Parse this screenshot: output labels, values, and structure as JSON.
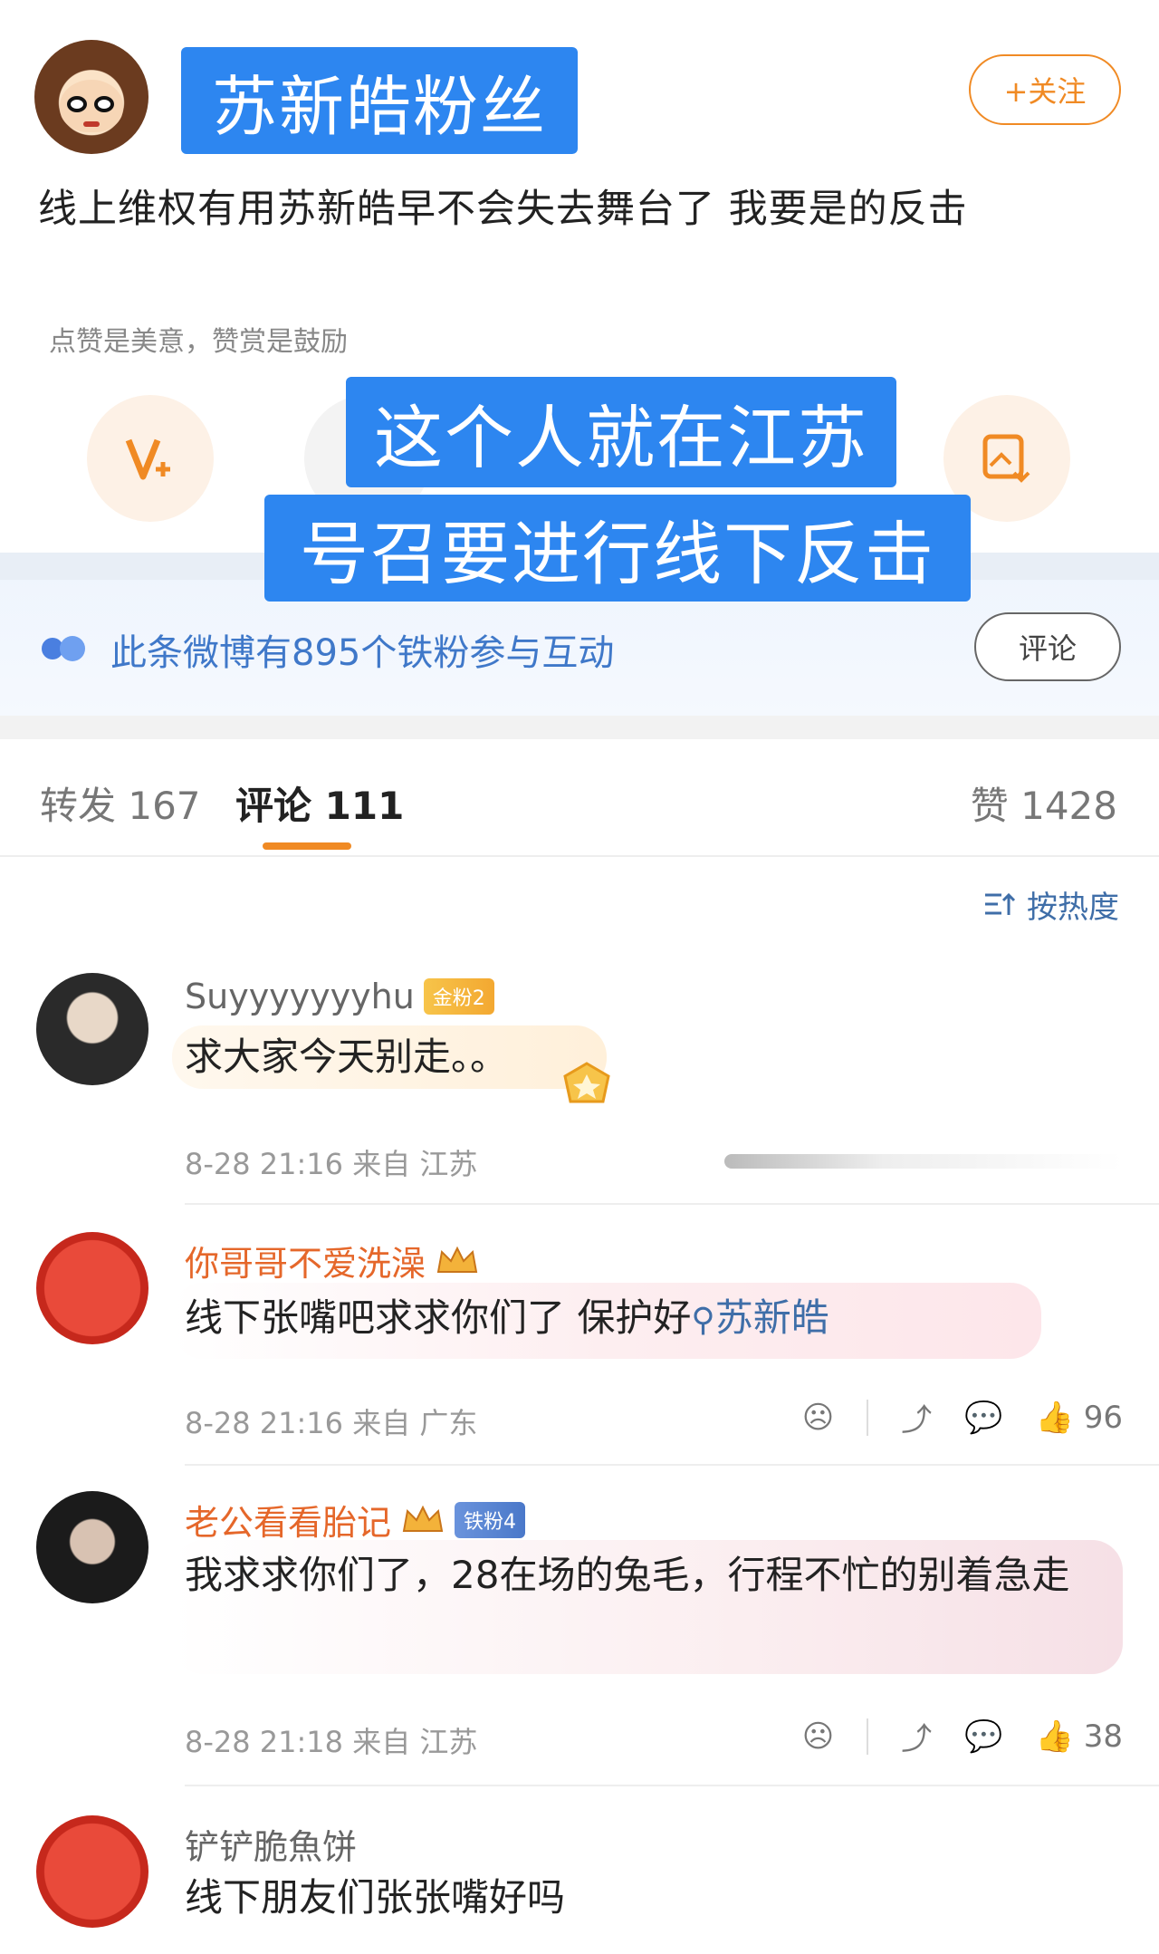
{
  "post": {
    "username": "苏新皓粉丝",
    "follow_label": "+关注",
    "text": "线上维权有用苏新皓早不会失去舞台了 我要是的反击",
    "reward_caption": "点赞是美意，赞赏是鼓励"
  },
  "overlay": {
    "line1": "这个人就在江苏",
    "line2": "号召要进行线下反击"
  },
  "fans_band": {
    "text": "此条微博有895个铁粉参与互动",
    "comment_button": "评论"
  },
  "tabs": {
    "repost": "转发 167",
    "comments": "评论 111",
    "likes": "赞 1428"
  },
  "sort_label": "按热度",
  "comments": [
    {
      "name": "Suyyyyyyyhu",
      "badge": "金粉2",
      "text": "求大家今天别走。。",
      "meta": "8-28 21:16 来自 江苏"
    },
    {
      "name": "你哥哥不爱洗澡",
      "text_prefix": "线下张嘴吧求求你们了 保护好",
      "text_link": "苏新皓",
      "meta": "8-28 21:16 来自 广东",
      "likes": "96"
    },
    {
      "name": "老公看看胎记",
      "badge": "铁粉4",
      "text": "我求求你们了，28在场的兔毛，行程不忙的别着急走",
      "meta": "8-28 21:18 来自 江苏",
      "likes": "38"
    },
    {
      "name": "铲铲脆魚饼",
      "text": "线下朋友们张张嘴好吗"
    }
  ],
  "colors": {
    "accent": "#f08a24",
    "highlight": "#2d86f0",
    "link": "#3f78c9"
  }
}
